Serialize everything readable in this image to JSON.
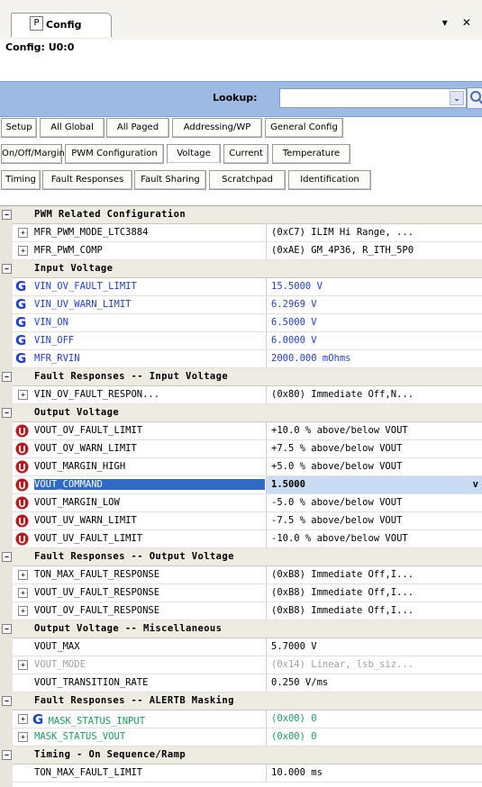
{
  "tab": {
    "title": "Config",
    "pin_letter": "P",
    "controls": "▾ ✕"
  },
  "header": {
    "config_label": "Config: U0:0"
  },
  "lookup": {
    "label": "Lookup:",
    "value": "",
    "dropdown_glyph": "⌄",
    "search_glyph": "🔍"
  },
  "tab_rows": [
    [
      "Setup",
      "All Global",
      "All Paged",
      "Addressing/WP",
      "General Config"
    ],
    [
      "On/Off/Margin",
      "PWM Configuration",
      "Voltage",
      "Current",
      "Temperature"
    ],
    [
      "Timing",
      "Fault Responses",
      "Fault Sharing",
      "Scratchpad",
      "Identification"
    ]
  ],
  "active_tab": "Voltage",
  "rows": [
    {
      "type": "cat",
      "text": "PWM Related Configuration"
    },
    {
      "icon": "plus",
      "name": "MFR_PWM_MODE_LTC3884",
      "value": "(0xC7) ILIM Hi Range, ..."
    },
    {
      "icon": "plus",
      "name": "MFR_PWM_COMP",
      "value": "(0xAE) GM_4P36, R_ITH_5P0"
    },
    {
      "type": "cat",
      "text": "Input Voltage"
    },
    {
      "icon": "g",
      "name": "VIN_OV_FAULT_LIMIT",
      "value": "15.5000 V",
      "color": "blue"
    },
    {
      "icon": "g",
      "name": "VIN_UV_WARN_LIMIT",
      "value": "6.2969 V",
      "color": "blue"
    },
    {
      "icon": "g",
      "name": "VIN_ON",
      "value": "6.5000 V",
      "color": "blue"
    },
    {
      "icon": "g",
      "name": "VIN_OFF",
      "value": "6.0000 V",
      "color": "blue"
    },
    {
      "icon": "g",
      "name": "MFR_RVIN",
      "value": "2000.000 mOhms",
      "color": "blue"
    },
    {
      "type": "cat",
      "text": "Fault Responses -- Input Voltage"
    },
    {
      "icon": "plus",
      "name": "VIN_OV_FAULT_RESPON...",
      "value": "(0x80) Immediate Off,N..."
    },
    {
      "type": "cat",
      "text": "Output Voltage"
    },
    {
      "icon": "u",
      "name": "VOUT_OV_FAULT_LIMIT",
      "value": "+10.0 % above/below VOUT"
    },
    {
      "icon": "u",
      "name": "VOUT_OV_WARN_LIMIT",
      "value": "+7.5 % above/below VOUT"
    },
    {
      "icon": "u",
      "name": "VOUT_MARGIN_HIGH",
      "value": "+5.0 % above/below VOUT"
    },
    {
      "icon": "u",
      "name": "VOUT_COMMAND",
      "value": "1.5000",
      "selected": true,
      "sel_glyph": "v"
    },
    {
      "icon": "u",
      "name": "VOUT_MARGIN_LOW",
      "value": "-5.0 % above/below VOUT"
    },
    {
      "icon": "u",
      "name": "VOUT_UV_WARN_LIMIT",
      "value": "-7.5 % above/below VOUT"
    },
    {
      "icon": "u",
      "name": "VOUT_UV_FAULT_LIMIT",
      "value": "-10.0 % above/below VOUT"
    },
    {
      "type": "cat",
      "text": "Fault Responses -- Output Voltage"
    },
    {
      "icon": "plus",
      "name": "TON_MAX_FAULT_RESPONSE",
      "value": "(0xB8) Immediate Off,I..."
    },
    {
      "icon": "plus",
      "name": "VOUT_UV_FAULT_RESPONSE",
      "value": "(0xB8) Immediate Off,I..."
    },
    {
      "icon": "plus",
      "name": "VOUT_OV_FAULT_RESPONSE",
      "value": "(0xB8) Immediate Off,I..."
    },
    {
      "type": "cat",
      "text": "Output Voltage -- Miscellaneous"
    },
    {
      "icon": "none",
      "name": "VOUT_MAX",
      "value": "5.7000 V"
    },
    {
      "icon": "plus",
      "name": "VOUT_MODE",
      "value": "(0x14) Linear, lsb_siz...",
      "color": "gray"
    },
    {
      "icon": "none",
      "name": "VOUT_TRANSITION_RATE",
      "value": "0.250 V/ms"
    },
    {
      "type": "cat",
      "text": "Fault Responses -- ALERTB Masking"
    },
    {
      "icon": "plusg",
      "name": "MASK_STATUS_INPUT",
      "value": "(0x00) 0",
      "color": "green"
    },
    {
      "icon": "plus",
      "name": "MASK_STATUS_VOUT",
      "value": "(0x00) 0",
      "color": "green"
    },
    {
      "type": "cat",
      "text": "Timing - On Sequence/Ramp"
    },
    {
      "icon": "none",
      "name": "TON_MAX_FAULT_LIMIT",
      "value": "10.000 ms"
    }
  ],
  "colors": {
    "accent": "#316ac5",
    "lookup_bar": "#9dbae4",
    "link_blue": "#1f3fd6",
    "green": "#1aa05a",
    "red_icon": "#c0161b"
  }
}
